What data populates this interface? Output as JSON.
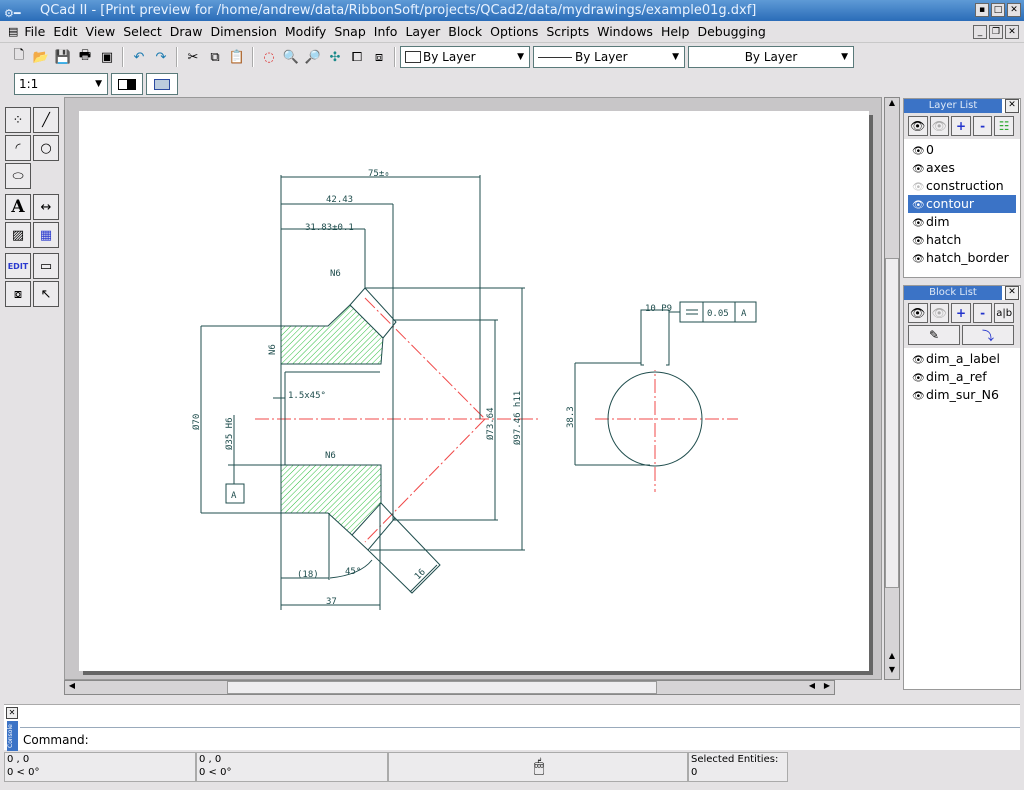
{
  "window": {
    "title": "QCad II - [Print preview for /home/andrew/data/RibbonSoft/projects/QCad2/data/mydrawings/example01g.dxf]"
  },
  "menu": [
    {
      "label": "File"
    },
    {
      "label": "Edit"
    },
    {
      "label": "View"
    },
    {
      "label": "Select"
    },
    {
      "label": "Draw"
    },
    {
      "label": "Dimension"
    },
    {
      "label": "Modify"
    },
    {
      "label": "Snap"
    },
    {
      "label": "Info"
    },
    {
      "label": "Layer"
    },
    {
      "label": "Block"
    },
    {
      "label": "Options"
    },
    {
      "label": "Scripts"
    },
    {
      "label": "Windows"
    },
    {
      "label": "Help"
    },
    {
      "label": "Debugging"
    }
  ],
  "toolbar": {
    "color": "By Layer",
    "linetype": "By Layer",
    "linewidth": "By Layer",
    "scale": "1:1"
  },
  "layer_list": {
    "title": "Layer List",
    "layers": [
      {
        "name": "0",
        "visible": true
      },
      {
        "name": "axes",
        "visible": true
      },
      {
        "name": "construction",
        "visible": false
      },
      {
        "name": "contour",
        "visible": true,
        "selected": true
      },
      {
        "name": "dim",
        "visible": true
      },
      {
        "name": "hatch",
        "visible": true
      },
      {
        "name": "hatch_border",
        "visible": true
      }
    ]
  },
  "block_list": {
    "title": "Block List",
    "blocks": [
      {
        "name": "dim_a_label"
      },
      {
        "name": "dim_a_ref"
      },
      {
        "name": "dim_sur_N6"
      }
    ]
  },
  "drawing": {
    "dims": {
      "d75": "75±₀",
      "d4243": "42.43",
      "d3183": "31.83±0.1",
      "n6a": "N6",
      "n6b": "N6",
      "n6c": "N6",
      "chamfer": "1.5x45°",
      "d70": "Ø70",
      "d35": "Ø35 H6",
      "d7364": "Ø73.64",
      "d9746": "Ø97.46 h11",
      "d18": "(18)",
      "a45": "45°",
      "d16": "16",
      "d37": "37",
      "datum": "A",
      "key": "10 P9",
      "tol_val": "0.05",
      "tol_ref": "A",
      "d383": "38.3"
    },
    "colors": {
      "contour": "#1f4d4d",
      "hatch": "#2fbf3f",
      "axis": "#f04848"
    }
  },
  "console": {
    "tab": "Console",
    "prompt": "Command:"
  },
  "status": {
    "abs_coord": "0 , 0",
    "abs_polar": "0 < 0°",
    "rel_coord": "0 , 0",
    "rel_polar": "0 < 0°",
    "selected_label": "Selected Entities:",
    "selected_count": "0"
  }
}
